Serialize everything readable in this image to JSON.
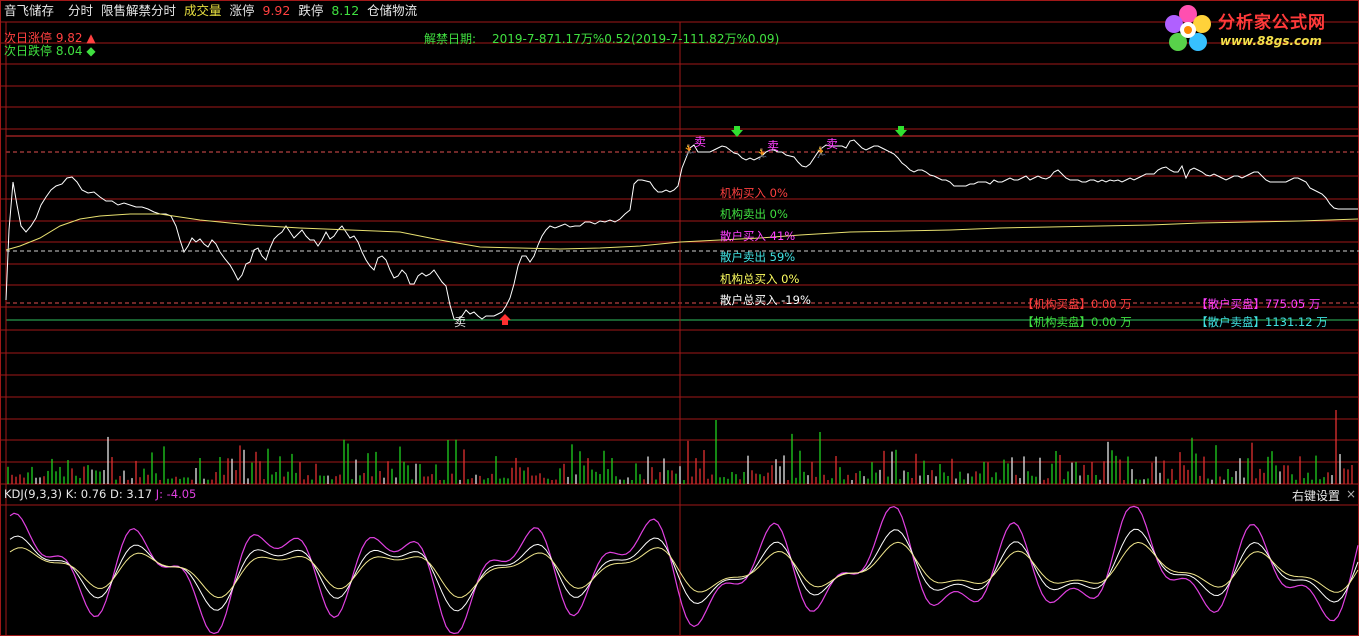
{
  "header": {
    "stock_name": "音飞储存",
    "mode": "分时",
    "indicator_name": "限售解禁分时",
    "volume_label": "成交量",
    "limit_up_label": "涨停",
    "limit_up_value": "9.92",
    "limit_down_label": "跌停",
    "limit_down_value": "8.12",
    "sector": "仓储物流"
  },
  "next_day": {
    "up_label": "次日涨停 9.82 ▲",
    "down_label": "次日跌停 8.04 ◆"
  },
  "unlock": {
    "label": "解禁日期:",
    "value": "2019-7-871.17万%0.52(2019-7-111.82万%0.09)"
  },
  "ratios": [
    {
      "text": "机构买入 0%",
      "color": "#ff4040"
    },
    {
      "text": "机构卖出 0%",
      "color": "#40e040"
    },
    {
      "text": "散户买入 41%",
      "color": "#ff40ff"
    },
    {
      "text": "散户卖出 59%",
      "color": "#40e0e0"
    },
    {
      "text": "机构总买入 0%",
      "color": "#ffff60"
    },
    {
      "text": "散户总买入 -19%",
      "color": "#ffffff"
    }
  ],
  "orders": {
    "inst_buy": "【机构买盘】0.00 万",
    "retail_buy": "【散户买盘】775.05 万",
    "inst_sell": "【机构卖盘】0.00 万",
    "retail_sell": "【散户卖盘】1131.12 万"
  },
  "signals": {
    "sell_label": "卖"
  },
  "kdj": {
    "label": "KDJ(9,3,3)",
    "k": "K: 0.76",
    "d": "D: 3.17",
    "j": "J: -4.05",
    "settings_label": "右键设置",
    "close_label": "×"
  },
  "logo": {
    "title": "分析家公式网",
    "url": "www.88gs.com"
  },
  "colors": {
    "grid_red": "#a01818",
    "price_line": "#ffffff",
    "avg_line": "#e8e070",
    "vol_up": "#e03030",
    "vol_down": "#20d020",
    "kdj_j": "#e040e0"
  }
}
